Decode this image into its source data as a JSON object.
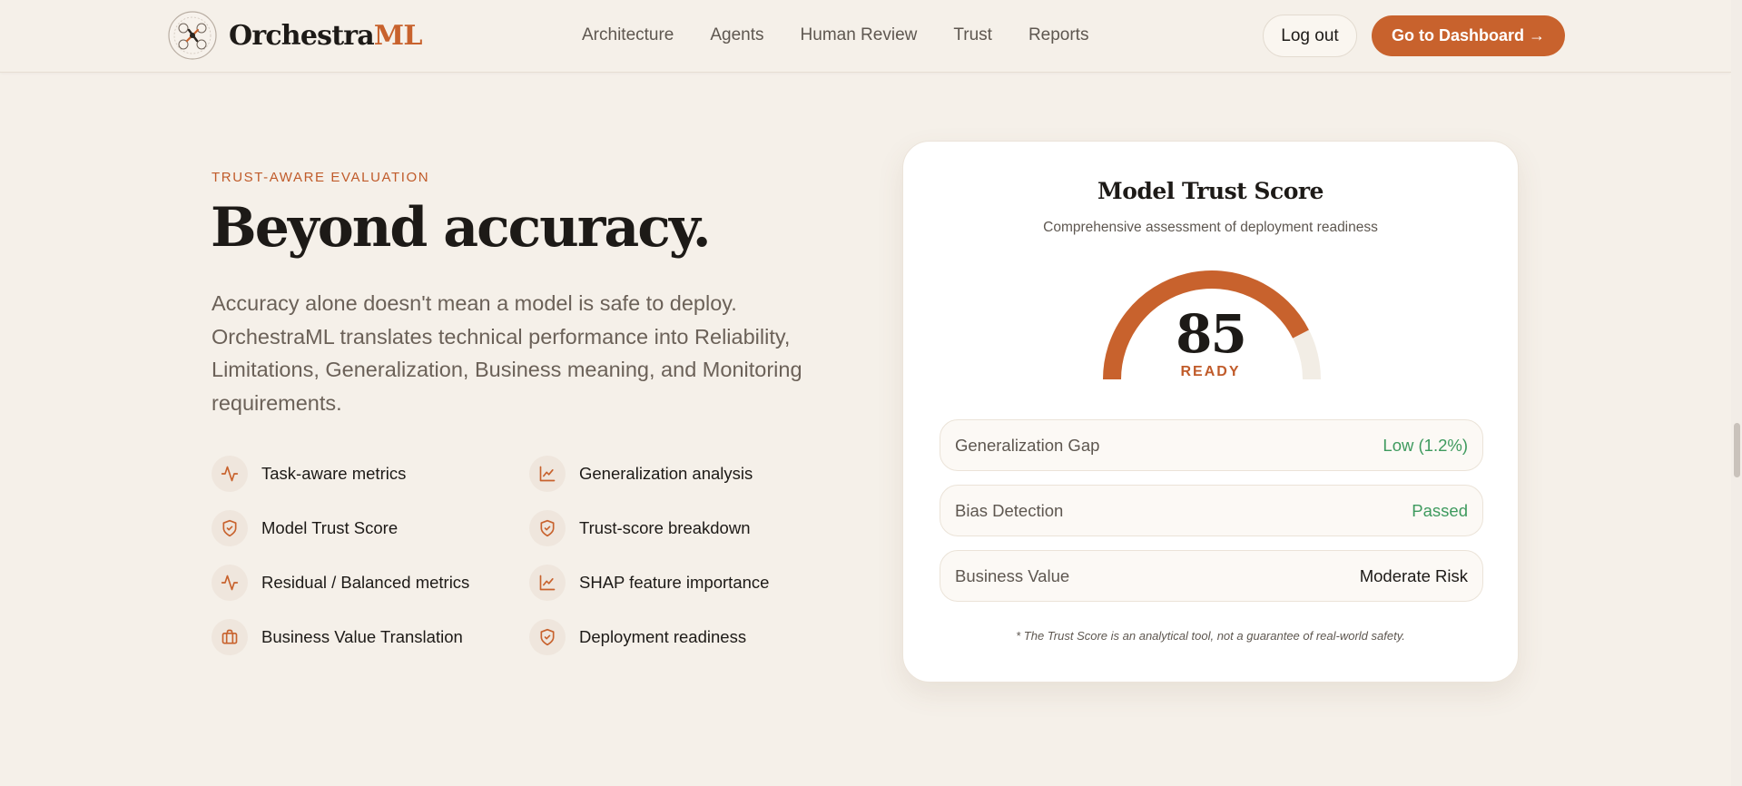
{
  "header": {
    "brand_primary": "Orchestra",
    "brand_accent": "ML",
    "nav": [
      "Architecture",
      "Agents",
      "Human Review",
      "Trust",
      "Reports"
    ],
    "logout_label": "Log out",
    "dashboard_label": "Go to Dashboard",
    "dashboard_arrow": "→"
  },
  "section": {
    "eyebrow": "TRUST-AWARE EVALUATION",
    "headline": "Beyond accuracy.",
    "lead": "Accuracy alone doesn't mean a model is safe to deploy. OrchestraML translates technical performance into Reliability, Limitations, Generalization, Business meaning, and Monitoring requirements.",
    "features": [
      {
        "label": "Task-aware metrics",
        "icon": "activity-icon"
      },
      {
        "label": "Generalization analysis",
        "icon": "line-chart-icon"
      },
      {
        "label": "Model Trust Score",
        "icon": "shield-icon"
      },
      {
        "label": "Trust-score breakdown",
        "icon": "shield-icon"
      },
      {
        "label": "Residual / Balanced metrics",
        "icon": "activity-icon"
      },
      {
        "label": "SHAP feature importance",
        "icon": "line-chart-icon"
      },
      {
        "label": "Business Value Translation",
        "icon": "briefcase-icon"
      },
      {
        "label": "Deployment readiness",
        "icon": "shield-icon"
      }
    ]
  },
  "trust_card": {
    "title": "Model Trust Score",
    "subtitle": "Comprehensive assessment of deployment readiness",
    "score": "85",
    "score_value": 85,
    "score_max": 100,
    "status": "READY",
    "metrics": [
      {
        "name": "Generalization Gap",
        "value": "Low (1.2%)",
        "tone": "good"
      },
      {
        "name": "Bias Detection",
        "value": "Passed",
        "tone": "good"
      },
      {
        "name": "Business Value",
        "value": "Moderate Risk",
        "tone": "neutral"
      }
    ],
    "disclaimer": "* The Trust Score is an analytical tool, not a guarantee of real-world safety."
  },
  "colors": {
    "accent": "#c8622d",
    "good": "#3e9a5e",
    "background": "#f5f0e9",
    "gauge_track": "#f2ede5"
  }
}
